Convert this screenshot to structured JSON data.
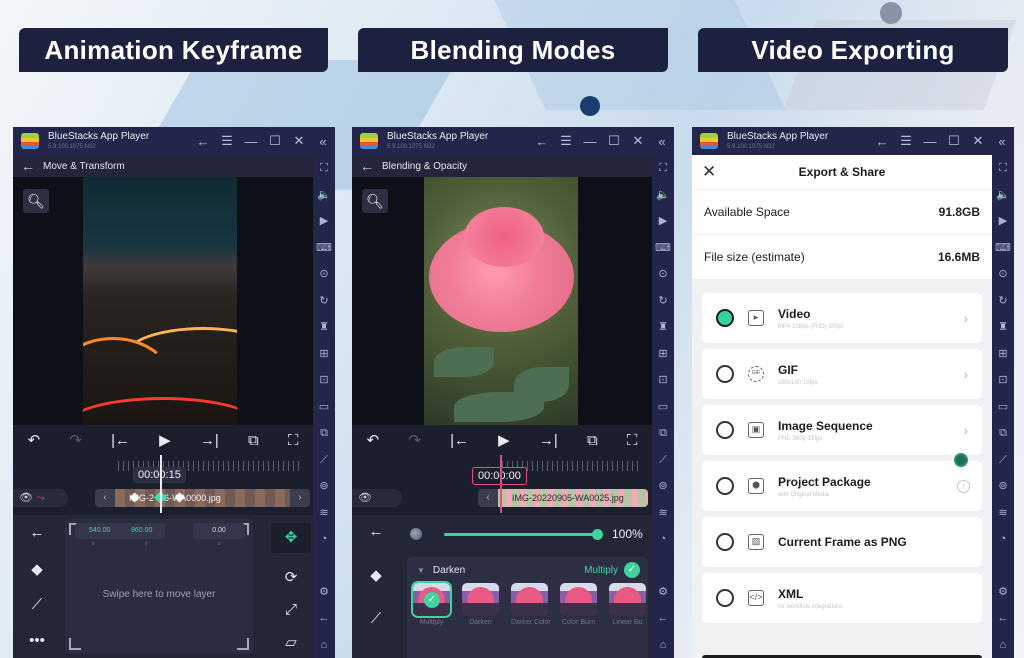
{
  "banners": [
    "Animation Keyframe",
    "Blending Modes",
    "Video Exporting"
  ],
  "emulator": {
    "title": "BlueStacks App Player",
    "version": "5.9.100.1075 N32",
    "titlebar_icons": [
      "back-arrow",
      "menu",
      "minimize",
      "maximize",
      "close",
      "collapse-sidebar"
    ],
    "titlebar_glyphs": [
      "←",
      "☰",
      "—",
      "☐",
      "✕",
      "«"
    ],
    "sidebar_icons": [
      "fullscreen",
      "volume",
      "screen-record",
      "keyboard-controls",
      "macro-play",
      "rotate",
      "instance-manager",
      "install-apk",
      "screenshot",
      "folder",
      "multi-instance",
      "eco-mode",
      "location",
      "layers",
      "performance",
      "settings",
      "back",
      "home"
    ],
    "sidebar_glyphs": [
      "⛶",
      "🔈",
      "▶",
      "⌨",
      "⊙",
      "↻",
      "♜",
      "⊞",
      "⊡",
      "▭",
      "⧉",
      "⟋",
      "⊚",
      "≋",
      "◔",
      "⚙",
      "←",
      "⌂"
    ]
  },
  "panel1": {
    "screen_title": "Move & Transform",
    "controls": [
      "↶",
      "↷",
      "|←",
      "▶",
      "→|",
      "⧉",
      "⛶"
    ],
    "timecode": "00:00:15",
    "clip_name": "IMG-20220905-WA0000.jpg",
    "clip_name_visible": "IMG-2  0  6-WA0000.jpg",
    "position": {
      "x": "540.00",
      "y": "960.00",
      "z": "0.00",
      "x_label": "x",
      "y_label": "y",
      "z_label": "z"
    },
    "pad_hint": "Swipe here to move layer",
    "left_tools": [
      "←",
      "◆",
      "⟋",
      "•••"
    ],
    "right_tools": [
      "✥",
      "⟳",
      "⤢",
      "▱"
    ],
    "active_tool": "move"
  },
  "panel2": {
    "screen_title": "Blending & Opacity",
    "controls": [
      "↶",
      "↷",
      "|←",
      "▶",
      "→|",
      "⧉",
      "⛶"
    ],
    "timecode": "00:00:00",
    "clip_name": "IMG-20220905-WA0025.jpg",
    "opacity_percent": 100,
    "opacity_label": "100%",
    "blend_group": "Darken",
    "selected_mode": "Multiply",
    "modes": [
      "Multiply",
      "Darken",
      "Darker Color",
      "Color Burn",
      "Linear Bu"
    ],
    "left_tools": [
      "←",
      "◆",
      "⟋"
    ]
  },
  "panel3": {
    "header": "Export & Share",
    "available_space_label": "Available Space",
    "available_space_value": "91.8GB",
    "file_size_label": "File size (estimate)",
    "file_size_value": "16.6MB",
    "options": [
      {
        "name": "Video",
        "sub": "MP4 1080p (FHD) 30fps",
        "icon": "video-icon",
        "glyph": "▸",
        "selected": true,
        "trail": "chevron"
      },
      {
        "name": "GIF",
        "sub": "180x180 15fps",
        "icon": "gif-icon",
        "glyph": "GIF",
        "selected": false,
        "trail": "chevron"
      },
      {
        "name": "Image Sequence",
        "sub": "PNG 360p 15fps",
        "icon": "image-sequence-icon",
        "glyph": "▣",
        "selected": false,
        "trail": "chevron"
      },
      {
        "name": "Project Package",
        "sub": "with Original Media",
        "icon": "package-icon",
        "glyph": "⬢",
        "selected": false,
        "trail": "info"
      },
      {
        "name": "Current Frame as PNG",
        "sub": "",
        "icon": "image-icon",
        "glyph": "▨",
        "selected": false,
        "trail": "none"
      },
      {
        "name": "XML",
        "sub": "for workflow integrations",
        "icon": "xml-icon",
        "glyph": "</>",
        "selected": false,
        "trail": "none"
      }
    ],
    "info_glyph": "i",
    "chevron_glyph": "›"
  },
  "colors": {
    "accent": "#3fd49e",
    "banner_bg": "#1c2140",
    "emulator_chrome": "#23264a",
    "playhead_pink": "#e0507a"
  }
}
